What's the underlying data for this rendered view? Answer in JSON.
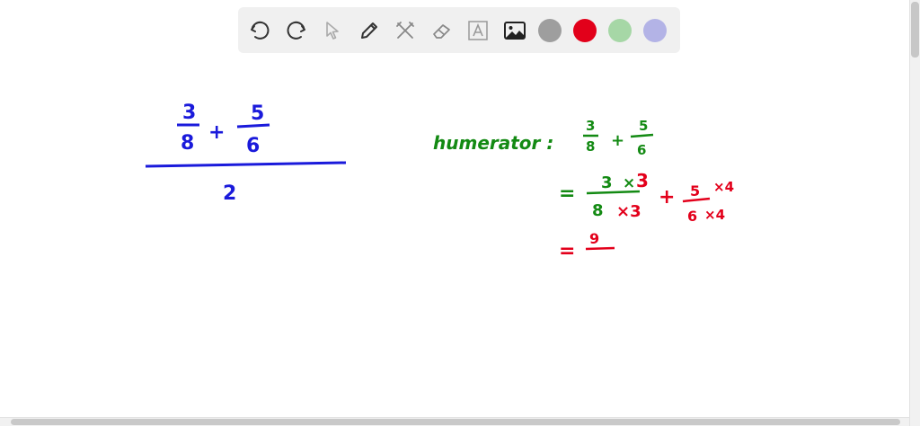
{
  "toolbar": {
    "tools": [
      {
        "name": "undo-icon"
      },
      {
        "name": "redo-icon"
      },
      {
        "name": "pointer-icon"
      },
      {
        "name": "pen-icon"
      },
      {
        "name": "tools-icon"
      },
      {
        "name": "eraser-icon"
      },
      {
        "name": "text-icon",
        "label": "A"
      },
      {
        "name": "image-icon"
      }
    ],
    "colors": [
      "#9e9e9e",
      "#e2001a",
      "#a6d7a6",
      "#b3b3e6"
    ]
  },
  "canvas": {
    "colors": {
      "blue": "#1a1adb",
      "green": "#138a13",
      "red": "#e3001b"
    },
    "left_expr": {
      "frac1_num": "3",
      "frac1_den": "8",
      "plus": "+",
      "frac2_num": "5",
      "frac2_den": "6",
      "denominator": "2"
    },
    "right_work": {
      "label": "humerator :",
      "frac1_num": "3",
      "frac1_den": "8",
      "plus": "+",
      "frac2_num": "5",
      "frac2_den": "6",
      "eq1": "=",
      "s1_num": "3",
      "s1_num_mult": "×",
      "s1_num_factor": "3",
      "s1_den": "8",
      "s1_den_mult": "×3",
      "plus2": "+",
      "s2_num": "5",
      "s2_num_mult": "×4",
      "s2_den": "6",
      "s2_den_mult": "×4",
      "eq2": "=",
      "s3_num": "9"
    }
  }
}
